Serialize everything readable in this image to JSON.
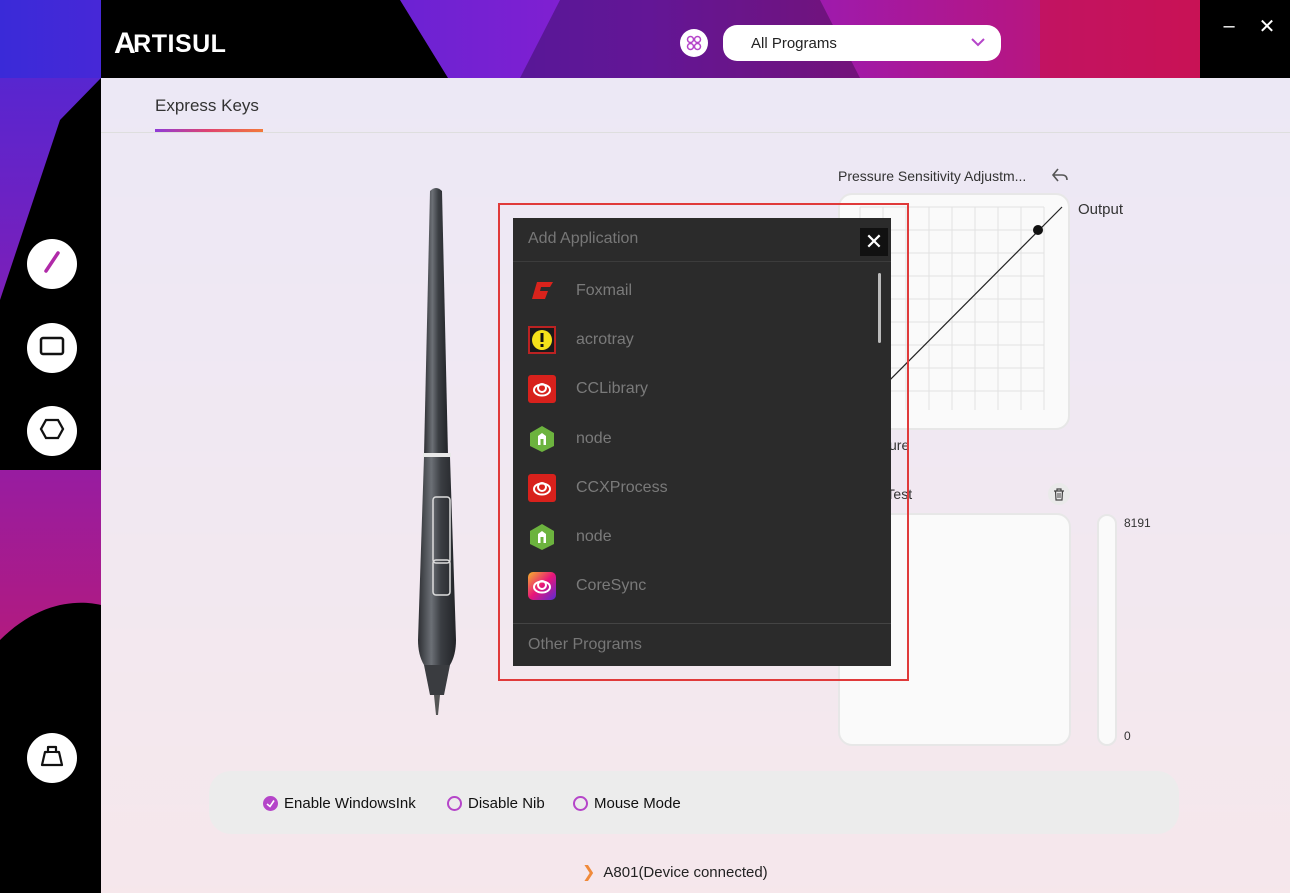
{
  "brand": {
    "logo_text": "RTISUL",
    "logo_mark": "A"
  },
  "header": {
    "program_icon": "program-group-icon",
    "program_select_value": "All Programs",
    "minimize_label": "–",
    "close_label": "✕"
  },
  "tabs": {
    "active_label": "Express Keys"
  },
  "sidebar": {
    "items": [
      {
        "icon": "pen-icon"
      },
      {
        "icon": "tablet-icon"
      },
      {
        "icon": "hexagon-icon"
      },
      {
        "icon": "weight-icon"
      }
    ]
  },
  "pressure": {
    "title": "Pressure Sensitivity Adjustm...",
    "output_label": "Output",
    "pressure_label": "ssure",
    "test_label": "e Test",
    "bar_max": "8191",
    "bar_min": "0"
  },
  "options": {
    "enable_windows_ink": "Enable WindowsInk",
    "disable_nib": "Disable Nib",
    "mouse_mode": "Mouse Mode",
    "enable_windows_ink_checked": true,
    "disable_nib_checked": false,
    "mouse_mode_checked": false
  },
  "status": {
    "device": "A801(Device connected)"
  },
  "dialog": {
    "title": "Add Application",
    "close_label": "✕",
    "apps": [
      {
        "name": "Foxmail",
        "icon": "foxmail-icon"
      },
      {
        "name": "acrotray",
        "icon": "acrotray-icon"
      },
      {
        "name": "CCLibrary",
        "icon": "creative-cloud-icon"
      },
      {
        "name": "node",
        "icon": "node-icon"
      },
      {
        "name": "CCXProcess",
        "icon": "creative-cloud-icon"
      },
      {
        "name": "node",
        "icon": "node-icon"
      },
      {
        "name": "CoreSync",
        "icon": "coresync-icon"
      }
    ],
    "other_programs": "Other Programs"
  },
  "colors": {
    "accent_purple": "#b545c9",
    "highlight_red": "#e03a3a",
    "dialog_bg": "#2b2b2b"
  }
}
